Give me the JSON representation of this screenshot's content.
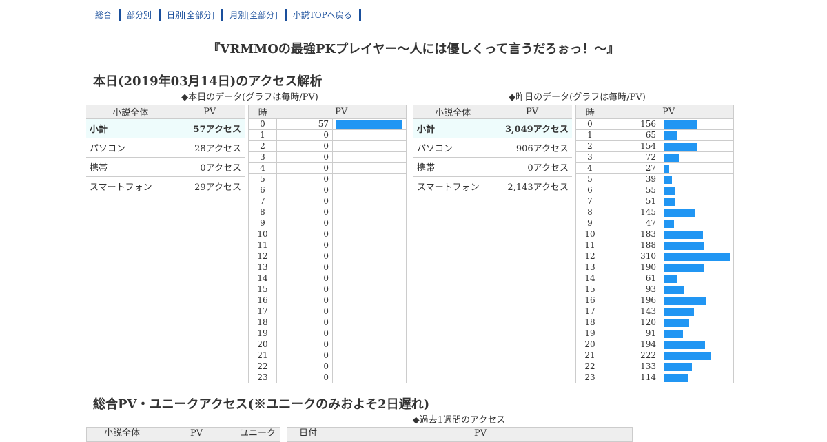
{
  "nav": {
    "items": [
      "総合",
      "部分別",
      "日別[全部分]",
      "月別[全部分]",
      "小説TOPへ戻る"
    ]
  },
  "novel_title": "『VRMMOの最強PKプレイヤー〜人には優しくって言うだろぉっ！〜』",
  "today_section": {
    "heading": "本日(2019年03月14日)のアクセス解析",
    "caption_today": "◆本日のデータ(グラフは毎時/PV)",
    "caption_yesterday": "◆昨日のデータ(グラフは毎時/PV)"
  },
  "summary_headers": [
    "小説全体",
    "PV"
  ],
  "hour_headers": [
    "時",
    "PV"
  ],
  "today_summary": [
    {
      "label": "小計",
      "value": "57アクセス"
    },
    {
      "label": "パソコン",
      "value": "28アクセス"
    },
    {
      "label": "携帯",
      "value": "0アクセス"
    },
    {
      "label": "スマートフォン",
      "value": "29アクセス"
    }
  ],
  "yesterday_summary": [
    {
      "label": "小計",
      "value": "3,049アクセス"
    },
    {
      "label": "パソコン",
      "value": "906アクセス"
    },
    {
      "label": "携帯",
      "value": "0アクセス"
    },
    {
      "label": "スマートフォン",
      "value": "2,143アクセス"
    }
  ],
  "chart_data": [
    {
      "type": "bar",
      "categories": [
        "0",
        "1",
        "2",
        "3",
        "4",
        "5",
        "6",
        "7",
        "8",
        "9",
        "10",
        "11",
        "12",
        "13",
        "14",
        "15",
        "16",
        "17",
        "18",
        "19",
        "20",
        "21",
        "22",
        "23"
      ],
      "values": [
        57,
        0,
        0,
        0,
        0,
        0,
        0,
        0,
        0,
        0,
        0,
        0,
        0,
        0,
        0,
        0,
        0,
        0,
        0,
        0,
        0,
        0,
        0,
        0
      ],
      "xlabel": "時",
      "ylabel": "PV",
      "color": "#2196f3"
    },
    {
      "type": "bar",
      "categories": [
        "0",
        "1",
        "2",
        "3",
        "4",
        "5",
        "6",
        "7",
        "8",
        "9",
        "10",
        "11",
        "12",
        "13",
        "14",
        "15",
        "16",
        "17",
        "18",
        "19",
        "20",
        "21",
        "22",
        "23"
      ],
      "values": [
        156,
        65,
        154,
        72,
        27,
        39,
        55,
        51,
        145,
        47,
        183,
        188,
        310,
        190,
        61,
        93,
        196,
        143,
        120,
        91,
        194,
        222,
        133,
        114
      ],
      "xlabel": "時",
      "ylabel": "PV",
      "color": "#2196f3"
    }
  ],
  "total_section": {
    "heading": "総合PV・ユニークアクセス(※ユニークのみおよそ2日遅れ)",
    "caption_week": "◆過去1週間のアクセス",
    "left_headers": [
      "小説全体",
      "PV",
      "ユニーク"
    ],
    "right_headers": [
      "日付",
      "PV"
    ]
  }
}
